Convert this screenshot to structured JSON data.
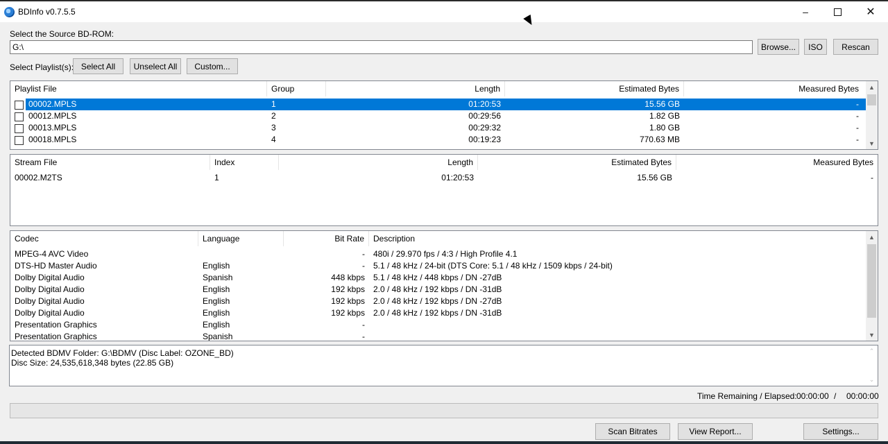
{
  "window": {
    "title": "BDInfo v0.7.5.5",
    "minimize_icon": "minimize-icon",
    "maximize_icon": "maximize-icon",
    "close_icon": "close-icon"
  },
  "source": {
    "label": "Select the Source BD-ROM:",
    "path": "G:\\",
    "browse_label": "Browse...",
    "iso_label": "ISO",
    "rescan_label": "Rescan"
  },
  "playlist_controls": {
    "label": "Select Playlist(s):",
    "select_all": "Select All",
    "unselect_all": "Unselect All",
    "custom": "Custom..."
  },
  "playlists": {
    "headers": [
      "Playlist File",
      "Group",
      "Length",
      "Estimated Bytes",
      "Measured Bytes"
    ],
    "rows": [
      {
        "file": "00002.MPLS",
        "group": "1",
        "length": "01:20:53",
        "estimated": "15.56 GB",
        "measured": "-",
        "selected": true
      },
      {
        "file": "00012.MPLS",
        "group": "2",
        "length": "00:29:56",
        "estimated": "1.82 GB",
        "measured": "-",
        "selected": false
      },
      {
        "file": "00013.MPLS",
        "group": "3",
        "length": "00:29:32",
        "estimated": "1.80 GB",
        "measured": "-",
        "selected": false
      },
      {
        "file": "00018.MPLS",
        "group": "4",
        "length": "00:19:23",
        "estimated": "770.63 MB",
        "measured": "-",
        "selected": false
      }
    ]
  },
  "streams": {
    "headers": [
      "Stream File",
      "Index",
      "Length",
      "Estimated Bytes",
      "Measured Bytes"
    ],
    "rows": [
      {
        "file": "00002.M2TS",
        "index": "1",
        "length": "01:20:53",
        "estimated": "15.56 GB",
        "measured": "-"
      }
    ]
  },
  "codecs": {
    "headers": [
      "Codec",
      "Language",
      "Bit Rate",
      "Description"
    ],
    "rows": [
      {
        "codec": "MPEG-4 AVC Video",
        "language": "",
        "bitrate": "-",
        "description": "480i / 29.970 fps / 4:3 / High Profile 4.1"
      },
      {
        "codec": "DTS-HD Master Audio",
        "language": "English",
        "bitrate": "-",
        "description": "5.1 / 48 kHz / 24-bit (DTS Core: 5.1 / 48 kHz /  1509 kbps / 24-bit)"
      },
      {
        "codec": "Dolby Digital Audio",
        "language": "Spanish",
        "bitrate": "448 kbps",
        "description": "5.1 / 48 kHz /  448 kbps / DN -27dB"
      },
      {
        "codec": "Dolby Digital Audio",
        "language": "English",
        "bitrate": "192 kbps",
        "description": "2.0 / 48 kHz /  192 kbps / DN -31dB"
      },
      {
        "codec": "Dolby Digital Audio",
        "language": "English",
        "bitrate": "192 kbps",
        "description": "2.0 / 48 kHz /  192 kbps / DN -27dB"
      },
      {
        "codec": "Dolby Digital Audio",
        "language": "English",
        "bitrate": "192 kbps",
        "description": "2.0 / 48 kHz /  192 kbps / DN -31dB"
      },
      {
        "codec": "Presentation Graphics",
        "language": "English",
        "bitrate": "-",
        "description": ""
      },
      {
        "codec": "Presentation Graphics",
        "language": "Spanish",
        "bitrate": "-",
        "description": ""
      }
    ]
  },
  "log": {
    "line1": "Detected BDMV Folder: G:\\BDMV (Disc Label: OZONE_BD)",
    "line2": "Disc Size: 24,535,618,348 bytes (22.85 GB)"
  },
  "status": {
    "time_label": "Time Remaining / Elapsed:",
    "remaining": "00:00:00",
    "separator": "/",
    "elapsed": "00:00:00",
    "progress": 0
  },
  "actions": {
    "scan_bitrates": "Scan Bitrates",
    "view_report": "View Report...",
    "settings": "Settings..."
  },
  "icons": {
    "up": "chevron-up-icon",
    "down": "chevron-down-icon"
  }
}
